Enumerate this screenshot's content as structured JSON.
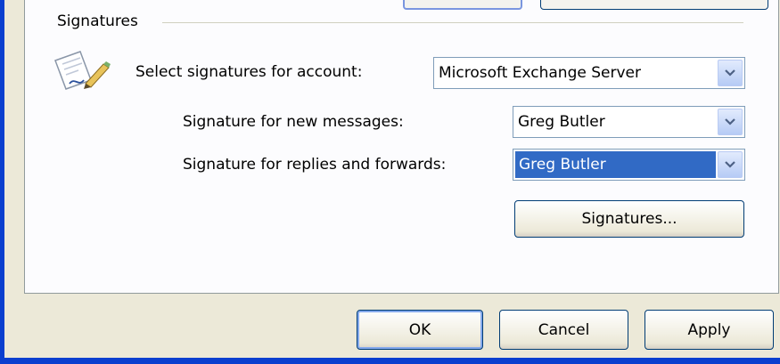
{
  "signatures_group": {
    "title": "Signatures",
    "account_label": "Select signatures for account:",
    "account_value": "Microsoft Exchange Server",
    "new_messages_label": "Signature for new messages:",
    "new_messages_value": "Greg Butler",
    "replies_label": "Signature for replies and forwards:",
    "replies_value": "Greg Butler",
    "signatures_button": "Signatures..."
  },
  "dialog_buttons": {
    "ok": "OK",
    "cancel": "Cancel",
    "apply": "Apply"
  },
  "icons": {
    "signature_icon": "signature-pen-icon",
    "dropdown_icon": "chevron-down-icon"
  },
  "colors": {
    "window_frame": "#0a3fcf",
    "dialog_background": "#ece9d8",
    "selection": "#316ac5"
  }
}
